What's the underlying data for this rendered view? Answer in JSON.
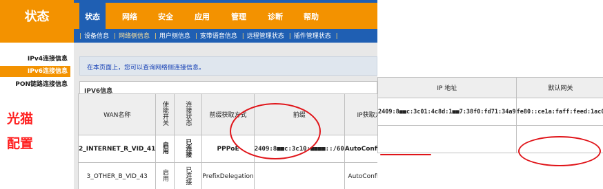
{
  "brand": {
    "title": "状态"
  },
  "top_nav": [
    {
      "label": "状态",
      "active": true
    },
    {
      "label": "网络"
    },
    {
      "label": "安全"
    },
    {
      "label": "应用"
    },
    {
      "label": "管理"
    },
    {
      "label": "诊断"
    },
    {
      "label": "帮助"
    }
  ],
  "sub_nav": [
    {
      "label": "设备信息"
    },
    {
      "label": "网络侧信息",
      "active": true
    },
    {
      "label": "用户侧信息"
    },
    {
      "label": "宽带语音信息"
    },
    {
      "label": "远程管理状态"
    },
    {
      "label": "插件管理状态"
    }
  ],
  "side_menu": [
    {
      "label": "IPv4连接信息"
    },
    {
      "label": "IPv6连接信息",
      "active": true
    },
    {
      "label": "PON链路连接信息"
    }
  ],
  "handwritten": {
    "line1": "光猫",
    "line2": "配置"
  },
  "info_text": "在本页面上，您可以查询网络侧连接信息。",
  "section_title": "IPV6信息",
  "headers": {
    "wan": "WAN名称",
    "enabled": "使能开关",
    "status": "连接状态",
    "prefix_method": "前缀获取方式",
    "prefix": "前缀",
    "ip_method": "IP获取方式",
    "ip_address": "IP 地址",
    "gateway": "默认网关"
  },
  "rows": [
    {
      "wan": "2_INTERNET_R_VID_41",
      "enabled": "启用",
      "status": "已连接",
      "prefix_method": "PPPoE",
      "prefix": "2409:8■■c:3c10:■■■■::/60",
      "ip_method": "AutoConfigured",
      "ip_address": "2409:8■■c:3c01:4c8d:1■■7:38f0:fd71:34a9",
      "gateway": "fe80::ce1a:faff:feed:1ac0"
    },
    {
      "wan": "3_OTHER_B_VID_43",
      "enabled": "启用",
      "status": "已连接",
      "prefix_method": "PrefixDelegation",
      "prefix": "",
      "ip_method": "AutoConfigured",
      "ip_address": "",
      "gateway": ""
    }
  ],
  "colors": {
    "accent": "#f39200",
    "nav_blue": "#1f5fb3",
    "annotation_red": "#e0151a"
  }
}
